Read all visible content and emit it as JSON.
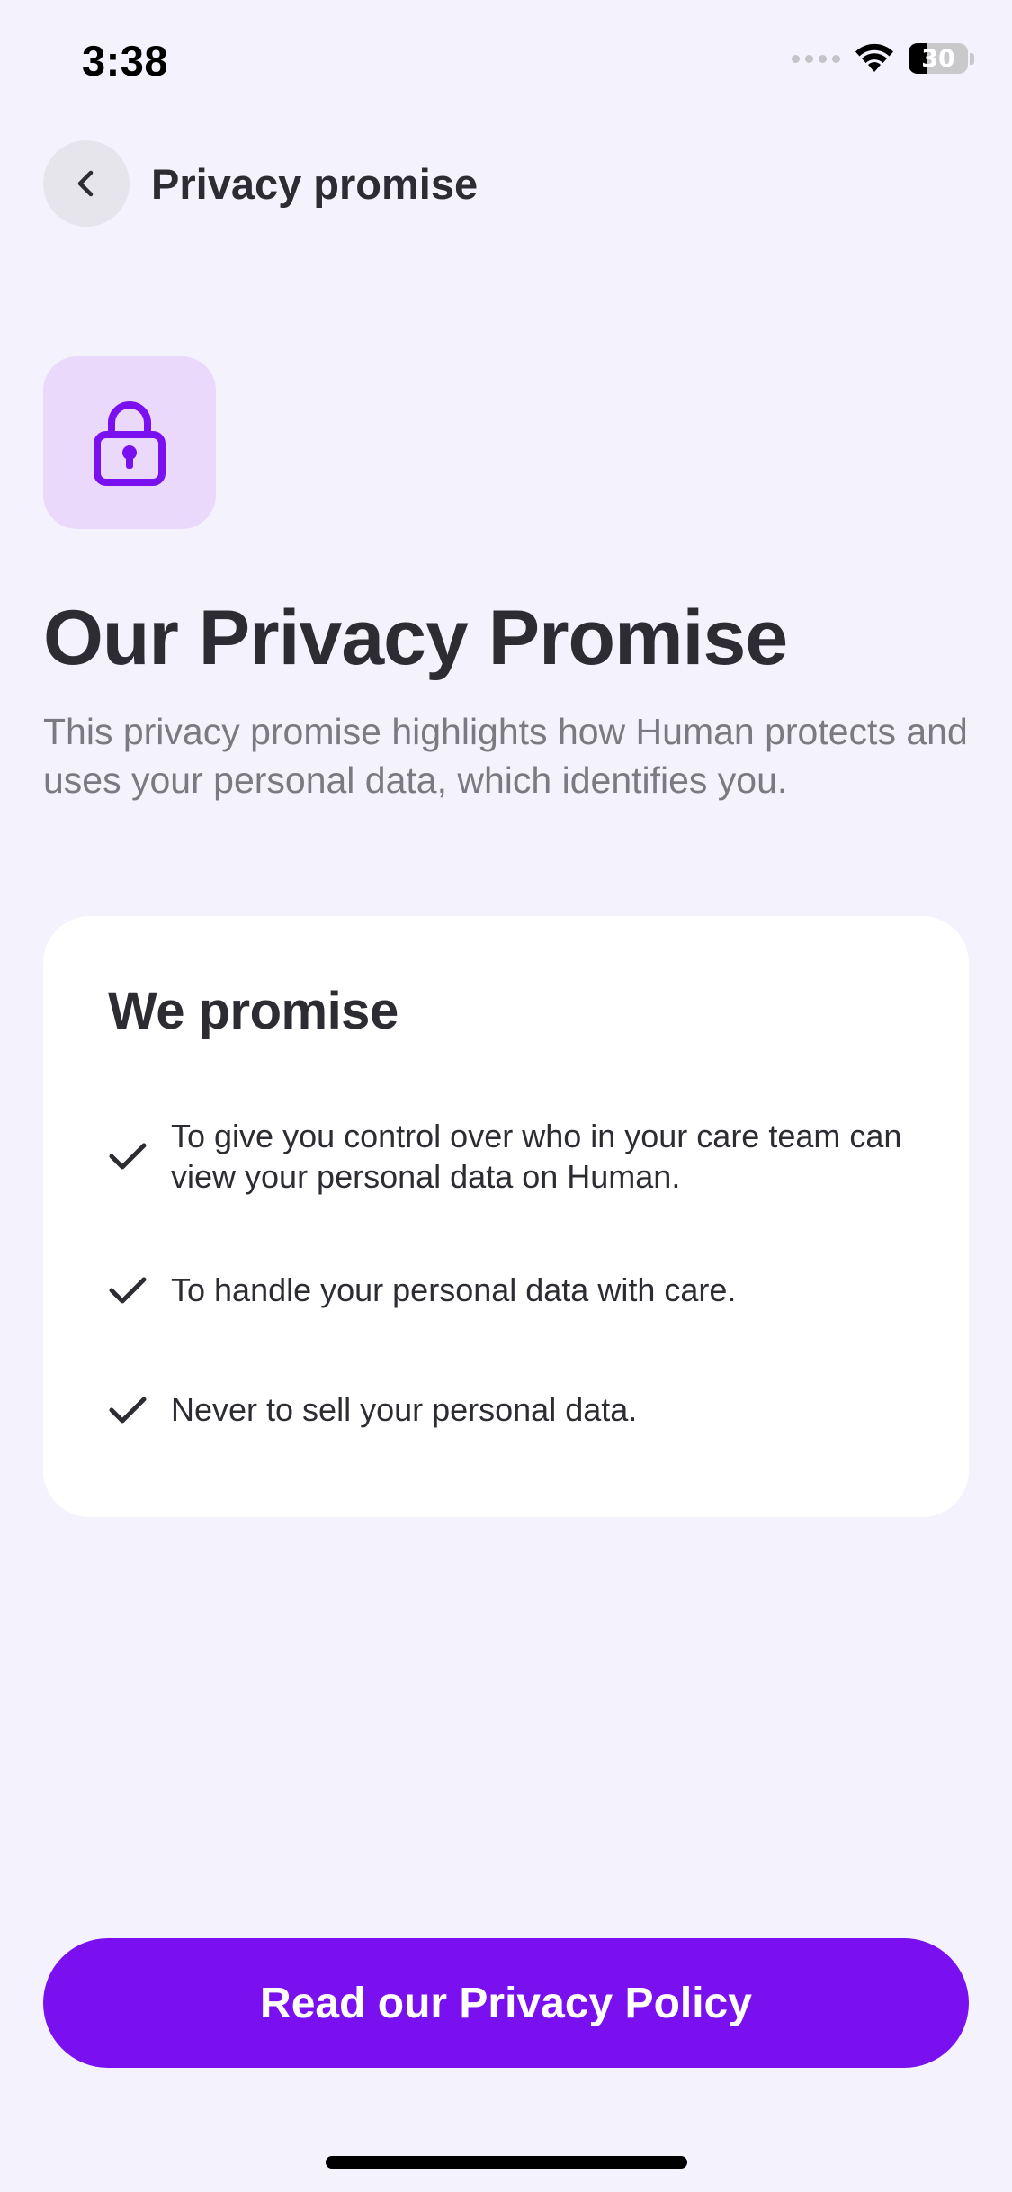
{
  "status_bar": {
    "time": "3:38",
    "battery_level": "30",
    "battery_fraction": 0.3
  },
  "header": {
    "back_icon": "chevron-left-icon",
    "title": "Privacy promise"
  },
  "hero": {
    "icon": "lock-icon",
    "title": "Our Privacy Promise",
    "subtitle": "This privacy promise highlights how Human protects and uses your personal data, which identifies you."
  },
  "promise_card": {
    "heading": "We promise",
    "items": [
      {
        "icon": "check-icon",
        "text": "To give you control over who in your care team can view your personal data on Human."
      },
      {
        "icon": "check-icon",
        "text": "To handle your personal data with care."
      },
      {
        "icon": "check-icon",
        "text": "Never to sell your personal data."
      }
    ]
  },
  "cta": {
    "label": "Read our Privacy Policy"
  },
  "colors": {
    "background": "#f4f3fd",
    "accent": "#7a0ff0",
    "lock_tile": "#ebd9fb",
    "text_primary": "#2d2c33",
    "text_secondary": "#7b7a82"
  }
}
